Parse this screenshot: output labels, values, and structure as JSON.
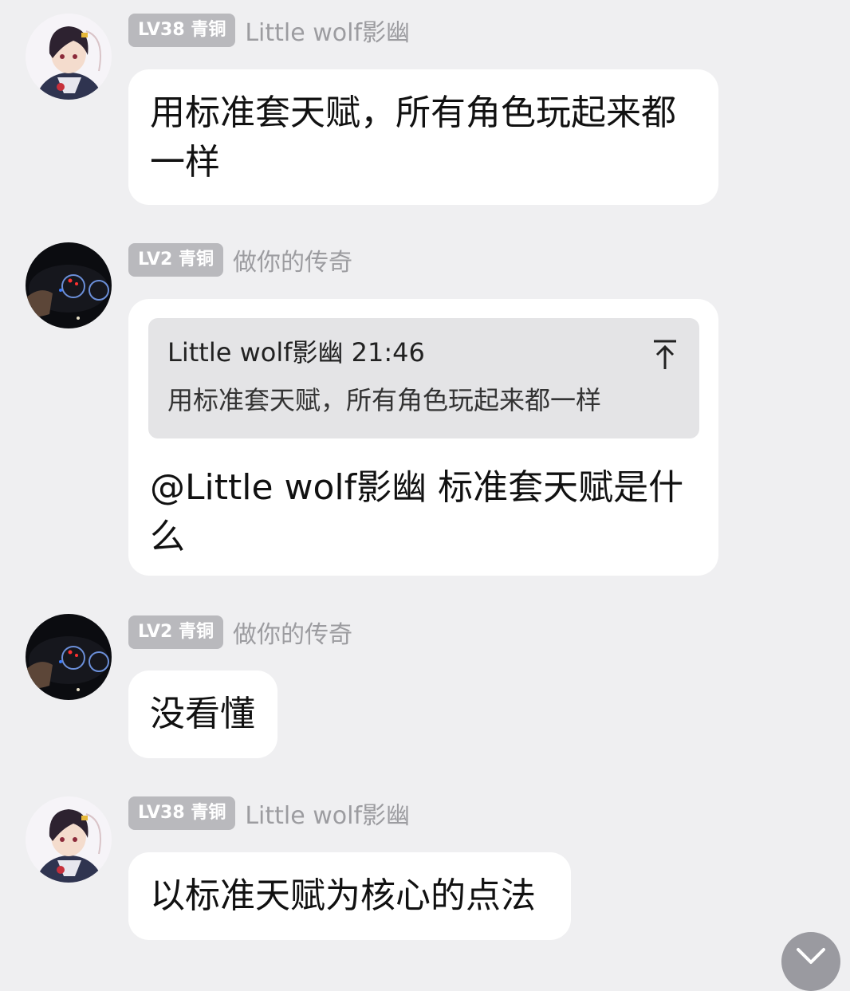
{
  "messages": [
    {
      "level": "LV38",
      "rank": "青铜",
      "name": "Little wolf影幽",
      "text": "用标准套天赋，所有角色玩起来都一样"
    },
    {
      "level": "LV2",
      "rank": "青铜",
      "name": "做你的传奇",
      "quote": {
        "author": "Little wolf影幽",
        "time": "21:46",
        "text": "用标准套天赋，所有角色玩起来都一样"
      },
      "mention": "@Little wolf影幽",
      "text": "标准套天赋是什么"
    },
    {
      "level": "LV2",
      "rank": "青铜",
      "name": "做你的传奇",
      "text": "没看懂"
    },
    {
      "level": "LV38",
      "rank": "青铜",
      "name": "Little wolf影幽",
      "text": "以标准天赋为核心的点法"
    }
  ],
  "icons": {
    "quote_jump": "arrow-to-top-icon",
    "scroll_down": "chevron-down-icon"
  },
  "colors": {
    "background": "#efeff1",
    "bubble": "#ffffff",
    "badge": "#b9b9bd",
    "name": "#9c9ca0",
    "quote": "#e4e4e6",
    "fab": "#9a9aa0"
  }
}
